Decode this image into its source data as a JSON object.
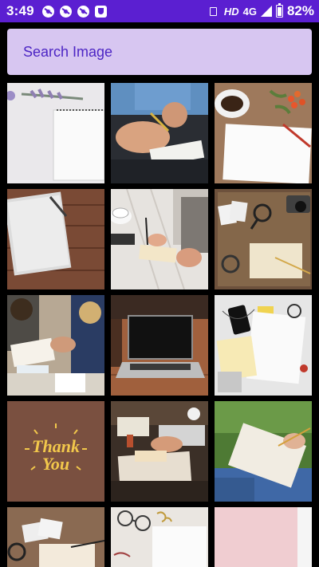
{
  "status_bar": {
    "time": "3:49",
    "hd": "HD",
    "network": "4G",
    "battery": "82%"
  },
  "search": {
    "placeholder": "Search Image"
  },
  "grid": {
    "items": [
      {
        "id": "notebook-lavender-photo"
      },
      {
        "id": "hands-writing-desk-photo"
      },
      {
        "id": "coffee-notepad-flowers-photo"
      },
      {
        "id": "notebook-wood-table-photo"
      },
      {
        "id": "woman-writing-coffee-photo"
      },
      {
        "id": "map-camera-notebook-photo"
      },
      {
        "id": "group-writing-meeting-photo"
      },
      {
        "id": "laptop-wood-table-photo"
      },
      {
        "id": "flatlay-notes-phone-photo"
      },
      {
        "id": "thank-you-card",
        "text_line1": "Thank",
        "text_line2": "You"
      },
      {
        "id": "desk-clutter-writing-photo"
      },
      {
        "id": "person-grass-notebook-photo"
      },
      {
        "id": "photos-notebook-table-photo"
      },
      {
        "id": "glasses-paper-clips-photo"
      },
      {
        "id": "pink-paper-photo"
      }
    ]
  }
}
